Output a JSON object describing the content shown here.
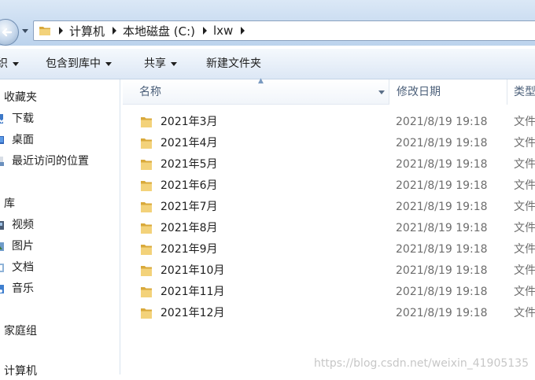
{
  "address": {
    "breadcrumbs": [
      "计算机",
      "本地磁盘 (C:)",
      "lxw"
    ]
  },
  "toolbar": {
    "organize_label": "织",
    "include_label": "包含到库中",
    "share_label": "共享",
    "new_folder_label": "新建文件夹"
  },
  "nav": {
    "favorites_header": "收藏夹",
    "downloads": "下载",
    "desktop": "桌面",
    "recent": "最近访问的位置",
    "libraries_header": "库",
    "videos": "视频",
    "pictures": "图片",
    "documents": "文档",
    "music": "音乐",
    "homegroup": "家庭组",
    "computer": "计算机"
  },
  "columns": {
    "name": "名称",
    "date": "修改日期",
    "type": "类型"
  },
  "files": [
    {
      "name": "2021年3月",
      "date": "2021/8/19 19:18",
      "type": "文件"
    },
    {
      "name": "2021年4月",
      "date": "2021/8/19 19:18",
      "type": "文件"
    },
    {
      "name": "2021年5月",
      "date": "2021/8/19 19:18",
      "type": "文件"
    },
    {
      "name": "2021年6月",
      "date": "2021/8/19 19:18",
      "type": "文件"
    },
    {
      "name": "2021年7月",
      "date": "2021/8/19 19:18",
      "type": "文件"
    },
    {
      "name": "2021年8月",
      "date": "2021/8/19 19:18",
      "type": "文件"
    },
    {
      "name": "2021年9月",
      "date": "2021/8/19 19:18",
      "type": "文件"
    },
    {
      "name": "2021年10月",
      "date": "2021/8/19 19:18",
      "type": "文件"
    },
    {
      "name": "2021年11月",
      "date": "2021/8/19 19:18",
      "type": "文件"
    },
    {
      "name": "2021年12月",
      "date": "2021/8/19 19:18",
      "type": "文件"
    }
  ],
  "watermark": "https://blog.csdn.net/weixin_41905135",
  "icons": {
    "folder": "folder-icon",
    "back": "back-arrow-icon"
  },
  "colors": {
    "folder_front": "#f3d27a",
    "folder_back": "#d9a93b",
    "toolbar_bg": "#e6eef8",
    "address_bg": "#c9dcf1"
  }
}
